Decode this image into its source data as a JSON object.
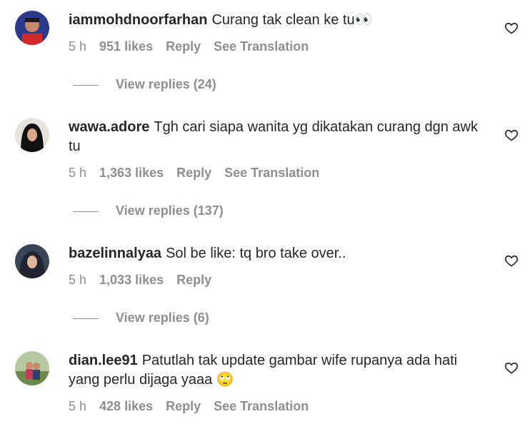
{
  "comments": [
    {
      "username": "iammohdnoorfarhan",
      "text": "Curang tak clean ke tu👀",
      "time": "5 h",
      "likes": "951 likes",
      "reply": "Reply",
      "translation": "See Translation",
      "view_replies": "View replies (24)"
    },
    {
      "username": "wawa.adore",
      "text": "Tgh cari siapa wanita yg dikatakan curang dgn awk tu",
      "time": "5 h",
      "likes": "1,363 likes",
      "reply": "Reply",
      "translation": "See Translation",
      "view_replies": "View replies (137)"
    },
    {
      "username": "bazelinnalyaa",
      "text": "Sol be like: tq bro take over..",
      "time": "5 h",
      "likes": "1,033 likes",
      "reply": "Reply",
      "view_replies": "View replies (6)"
    },
    {
      "username": "dian.lee91",
      "text": "Patutlah tak update gambar wife rupanya ada hati yang perlu dijaga yaaa 🙄",
      "time": "5 h",
      "likes": "428 likes",
      "reply": "Reply",
      "translation": "See Translation"
    }
  ]
}
